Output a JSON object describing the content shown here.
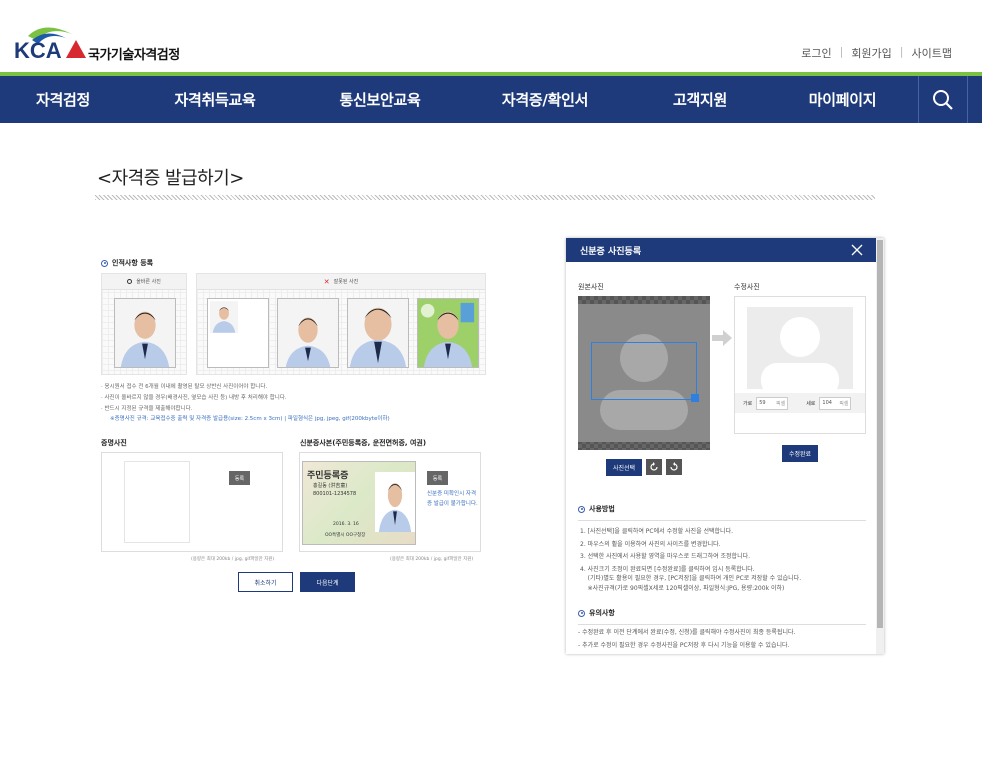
{
  "header": {
    "logo_text": "KCA",
    "org_name": "국가기술자격검정",
    "util_links": [
      "로그인",
      "회원가입",
      "사이트맵"
    ]
  },
  "nav": {
    "items": [
      "자격검정",
      "자격취득교육",
      "통신보안교육",
      "자격증/확인서",
      "고객지원",
      "마이페이지"
    ],
    "search_icon": "search-icon"
  },
  "page": {
    "title": "<자격증 발급하기>"
  },
  "left_panel": {
    "section1": "인적사항 등록",
    "good_label": "올바른 사진",
    "bad_label": "잘못된 사진",
    "notes": [
      "·  응시원서 접수 전 6개월 이내에 촬영된 탈모 상반신 사진이어야 합니다.",
      "·  사진이 올바르지 않을 경우(배경사진, 옆모습 사진 등) 내방 후 처리해야 합니다.",
      "·  반드시 지정된 규격을 제출해야합니다."
    ],
    "spec_note": "※증명사진 규격: 교육접수중 출력 및 자격증 발급용(size: 2.5cm x 3cm) | 파일형식은 jpg, jpeg, gif(200kbyte이하)",
    "id_photo_title": "증명사진",
    "id_card_title": "신분증사본(주민등록증, 운전면허증, 여권)",
    "register_btn": "등록",
    "card_title": "주민등록증",
    "card_name": "홍길동 (洪吉童)",
    "card_number": "800101-1234578",
    "card_date": "2016. 3. 16",
    "card_issuer": "OO특별시 OO구청장",
    "card_warn": "신분증 미확인시 자격증 발급이 불가합니다.",
    "caption": "(용량은 최대 200kb / jpg, gif파일만 지원)",
    "cancel_btn": "취소하기",
    "next_btn": "다음단계"
  },
  "modal": {
    "title": "신분증 사진등록",
    "original_label": "원본사진",
    "edited_label": "수정사진",
    "width_label": "가로",
    "width_value": "59",
    "height_label": "세로",
    "height_value": "104",
    "unit": "픽셀",
    "select_btn": "사진선택",
    "done_btn": "수정완료",
    "usage_title": "사용방법",
    "usage_lines": [
      "1. [사진선택]을 클릭하여 PC에서 수정할 사진을 선택합니다.",
      "2. 마우스의 휠을 이용하여 사진의 사이즈를 변경합니다.",
      "3. 선택한 사진에서 사용할 영역을 마우스로 드래그하여 조정합니다.",
      "4. 사진크기 조정이 완료되면 [수정완료]를 클릭하여 임시 등록합니다.",
      "    (기타)별도 활용이 필요한 경우, [PC저장]을 클릭하여 개인 PC로 저장할 수 있습니다.",
      "    ※사진규격(가로 90픽셀X세로 120픽셀이상, 파일형식:JPG, 용량:200k 이하)"
    ],
    "caution_title": "유의사항",
    "caution_lines": [
      "- 수정완료 후 이전 단계에서 완료(수정, 신청)를 클릭해야 수정사진이 최종 등록됩니다.",
      "- 추가로 수정이 필요한 경우 수정사진을 PC저장 후 다시 기능을 이용할 수 있습니다."
    ]
  },
  "colors": {
    "nav_bg": "#1e3a7a",
    "accent_green": "#7cc242",
    "logo_red": "#d7282f"
  }
}
